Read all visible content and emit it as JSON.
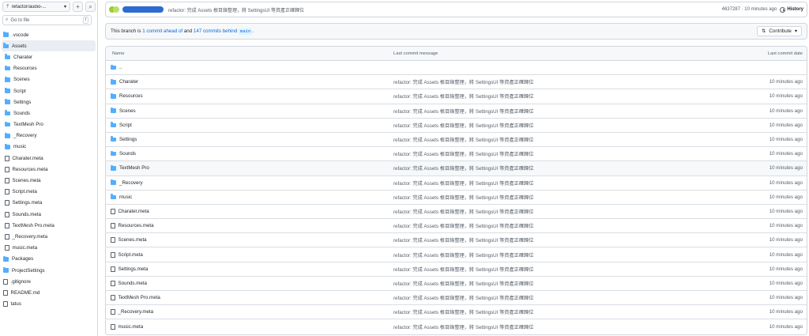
{
  "sidebar": {
    "branch": "refactor/audio-...",
    "goto_placeholder": "Go to file",
    "goto_shortcut": "t",
    "items": [
      {
        "label": ".vscode",
        "type": "folder",
        "level": 0
      },
      {
        "label": "Assets",
        "type": "folder",
        "level": 0,
        "active": true
      },
      {
        "label": "Charater",
        "type": "folder",
        "level": 1
      },
      {
        "label": "Resources",
        "type": "folder",
        "level": 1
      },
      {
        "label": "Scenes",
        "type": "folder",
        "level": 1
      },
      {
        "label": "Script",
        "type": "folder",
        "level": 1
      },
      {
        "label": "Settings",
        "type": "folder",
        "level": 1
      },
      {
        "label": "Sounds",
        "type": "folder",
        "level": 1
      },
      {
        "label": "TextMesh Pro",
        "type": "folder",
        "level": 1
      },
      {
        "label": "_Recovery",
        "type": "folder",
        "level": 1
      },
      {
        "label": "music",
        "type": "folder",
        "level": 1
      },
      {
        "label": "Charater.meta",
        "type": "file",
        "level": 1
      },
      {
        "label": "Resources.meta",
        "type": "file",
        "level": 1
      },
      {
        "label": "Scenes.meta",
        "type": "file",
        "level": 1
      },
      {
        "label": "Script.meta",
        "type": "file",
        "level": 1
      },
      {
        "label": "Settings.meta",
        "type": "file",
        "level": 1
      },
      {
        "label": "Sounds.meta",
        "type": "file",
        "level": 1
      },
      {
        "label": "TextMesh Pro.meta",
        "type": "file",
        "level": 1
      },
      {
        "label": "_Recovery.meta",
        "type": "file",
        "level": 1
      },
      {
        "label": "music.meta",
        "type": "file",
        "level": 1
      },
      {
        "label": "Packages",
        "type": "folder",
        "level": 0
      },
      {
        "label": "ProjectSettings",
        "type": "folder",
        "level": 0
      },
      {
        "label": ".gitignore",
        "type": "file",
        "level": 0
      },
      {
        "label": "README.md",
        "type": "file",
        "level": 0
      },
      {
        "label": "tatus",
        "type": "file",
        "level": 0
      }
    ]
  },
  "commit": {
    "message": "refactor: 完成 Assets 根目錄整理，將 SettingsUI 等資產正確歸位",
    "meta": "4637287 · 10 minutes ago",
    "history_label": "History"
  },
  "branch_info": {
    "prefix": "This branch is ",
    "ahead": "1 commit ahead of",
    "middle": " and ",
    "behind": "147 commits behind",
    "base": "main",
    "suffix": ".",
    "contribute_label": "Contribute"
  },
  "table": {
    "headers": {
      "name": "Name",
      "message": "Last commit message",
      "date": "Last commit date"
    },
    "parent_label": "..",
    "rows": [
      {
        "name": "Charater",
        "type": "folder",
        "message": "refactor: 完成 Assets 根目錄整理，將 SettingsUI 等資產正確歸位",
        "date": "10 minutes ago"
      },
      {
        "name": "Resources",
        "type": "folder",
        "message": "refactor: 完成 Assets 根目錄整理，將 SettingsUI 等資產正確歸位",
        "date": "10 minutes ago"
      },
      {
        "name": "Scenes",
        "type": "folder",
        "message": "refactor: 完成 Assets 根目錄整理，將 SettingsUI 等資產正確歸位",
        "date": "10 minutes ago"
      },
      {
        "name": "Script",
        "type": "folder",
        "message": "refactor: 完成 Assets 根目錄整理，將 SettingsUI 等資產正確歸位",
        "date": "10 minutes ago"
      },
      {
        "name": "Settings",
        "type": "folder",
        "message": "refactor: 完成 Assets 根目錄整理，將 SettingsUI 等資產正確歸位",
        "date": "10 minutes ago"
      },
      {
        "name": "Sounds",
        "type": "folder",
        "message": "refactor: 完成 Assets 根目錄整理，將 SettingsUI 等資產正確歸位",
        "date": "10 minutes ago"
      },
      {
        "name": "TextMesh Pro",
        "type": "folder",
        "message": "refactor: 完成 Assets 根目錄整理，將 SettingsUI 等資產正確歸位",
        "date": "10 minutes ago",
        "highlight": true
      },
      {
        "name": "_Recovery",
        "type": "folder",
        "message": "refactor: 完成 Assets 根目錄整理，將 SettingsUI 等資產正確歸位",
        "date": "10 minutes ago"
      },
      {
        "name": "music",
        "type": "folder",
        "message": "refactor: 完成 Assets 根目錄整理，將 SettingsUI 等資產正確歸位",
        "date": "10 minutes ago"
      },
      {
        "name": "Charater.meta",
        "type": "file",
        "message": "refactor: 完成 Assets 根目錄整理，將 SettingsUI 等資產正確歸位",
        "date": "10 minutes ago"
      },
      {
        "name": "Resources.meta",
        "type": "file",
        "message": "refactor: 完成 Assets 根目錄整理，將 SettingsUI 等資產正確歸位",
        "date": "10 minutes ago"
      },
      {
        "name": "Scenes.meta",
        "type": "file",
        "message": "refactor: 完成 Assets 根目錄整理，將 SettingsUI 等資產正確歸位",
        "date": "10 minutes ago"
      },
      {
        "name": "Script.meta",
        "type": "file",
        "message": "refactor: 完成 Assets 根目錄整理，將 SettingsUI 等資產正確歸位",
        "date": "10 minutes ago"
      },
      {
        "name": "Settings.meta",
        "type": "file",
        "message": "refactor: 完成 Assets 根目錄整理，將 SettingsUI 等資產正確歸位",
        "date": "10 minutes ago"
      },
      {
        "name": "Sounds.meta",
        "type": "file",
        "message": "refactor: 完成 Assets 根目錄整理，將 SettingsUI 等資產正確歸位",
        "date": "10 minutes ago"
      },
      {
        "name": "TextMesh Pro.meta",
        "type": "file",
        "message": "refactor: 完成 Assets 根目錄整理，將 SettingsUI 等資產正確歸位",
        "date": "10 minutes ago"
      },
      {
        "name": "_Recovery.meta",
        "type": "file",
        "message": "refactor: 完成 Assets 根目錄整理，將 SettingsUI 等資產正確歸位",
        "date": "10 minutes ago"
      },
      {
        "name": "music.meta",
        "type": "file",
        "message": "refactor: 完成 Assets 根目錄整理，將 SettingsUI 等資產正確歸位",
        "date": "10 minutes ago"
      }
    ]
  },
  "colors": {
    "folder": "#54aeff",
    "link": "#0969da",
    "border": "#d0d7de"
  }
}
